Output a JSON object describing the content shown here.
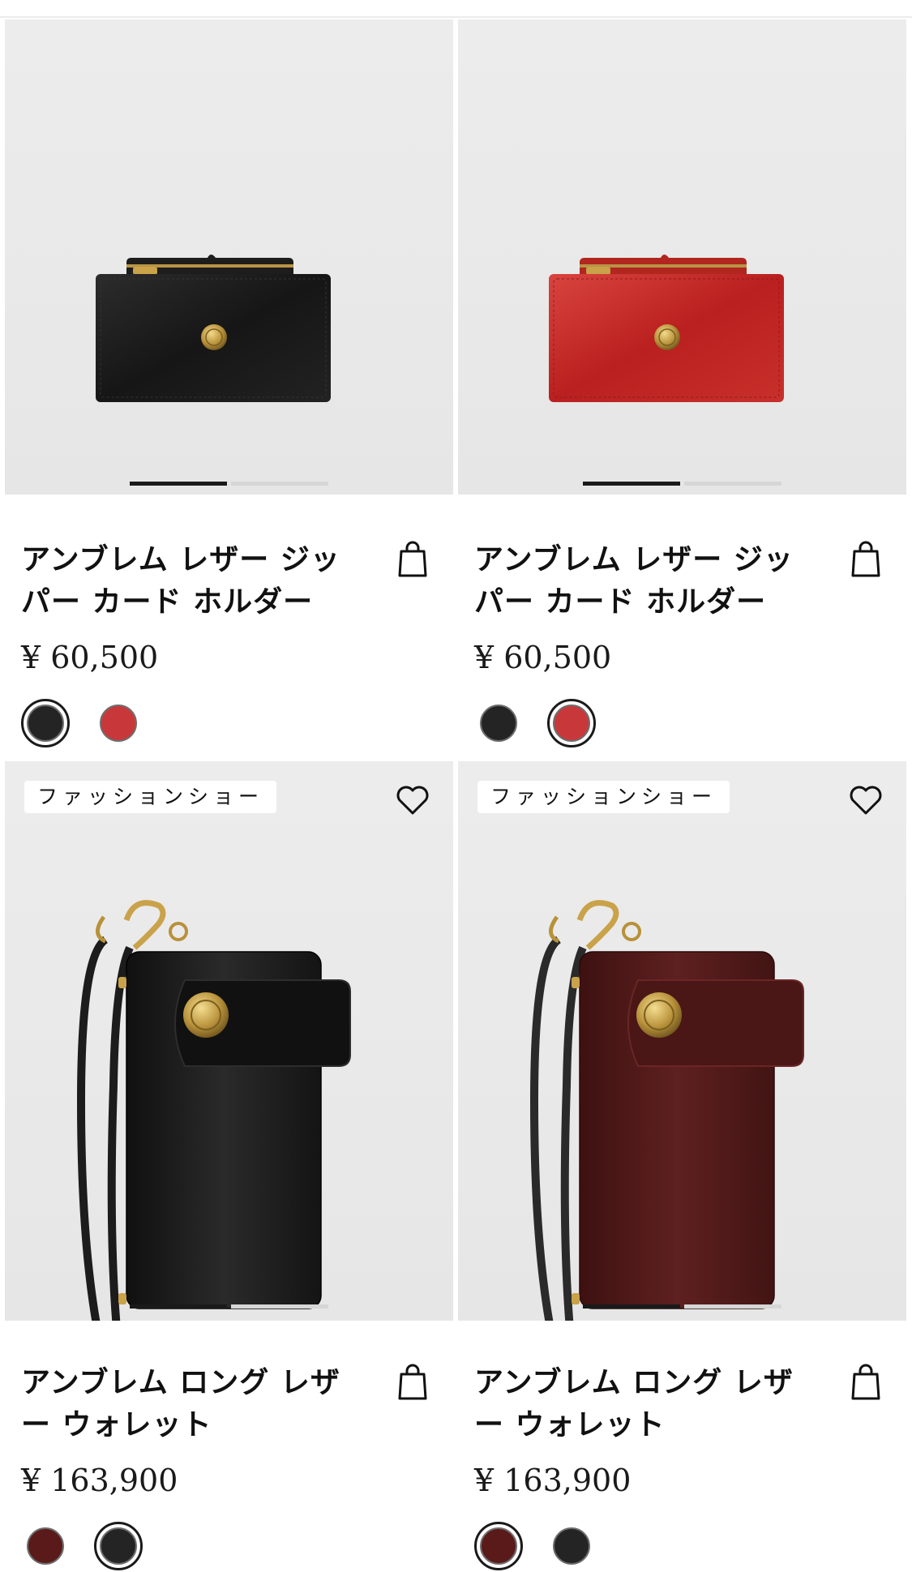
{
  "colors": {
    "black": "#242424",
    "red": "#c8383a",
    "burgundy": "#5a1a1a",
    "selected_ring": "#1a1a1a"
  },
  "products": [
    {
      "title": "アンブレム レザー ジッパー カード ホルダー",
      "price": "¥ 60,500",
      "badge": "",
      "icon": "shopping-bag-icon",
      "image": "black zip card holder with gold medusa medallion",
      "swatches": [
        {
          "color": "black",
          "selected": true
        },
        {
          "color": "red",
          "selected": false
        }
      ],
      "carousel": {
        "count": 2,
        "active": 1
      }
    },
    {
      "title": "アンブレム レザー ジッパー カード ホルダー",
      "price": "¥ 60,500",
      "badge": "",
      "icon": "shopping-bag-icon",
      "image": "red zip card holder with gold medusa medallion",
      "swatches": [
        {
          "color": "black",
          "selected": false
        },
        {
          "color": "red",
          "selected": true
        }
      ],
      "carousel": {
        "count": 2,
        "active": 1
      }
    },
    {
      "title": "アンブレム ロング レザー ウォレット",
      "price": "¥ 163,900",
      "badge": "ファッションショー",
      "icon": "shopping-bag-icon",
      "wishlist_icon": "heart-icon",
      "image": "black long leather wallet with wrist strap and gold clasp",
      "swatches": [
        {
          "color": "burgundy",
          "selected": false
        },
        {
          "color": "black",
          "selected": true
        }
      ],
      "carousel": {
        "count": 2,
        "active": 1
      }
    },
    {
      "title": "アンブレム ロング レザー ウォレット",
      "price": "¥ 163,900",
      "badge": "ファッションショー",
      "icon": "shopping-bag-icon",
      "wishlist_icon": "heart-icon",
      "image": "burgundy long leather wallet with wrist strap and gold clasp",
      "swatches": [
        {
          "color": "burgundy",
          "selected": true
        },
        {
          "color": "black",
          "selected": false
        }
      ],
      "carousel": {
        "count": 2,
        "active": 1
      }
    }
  ]
}
